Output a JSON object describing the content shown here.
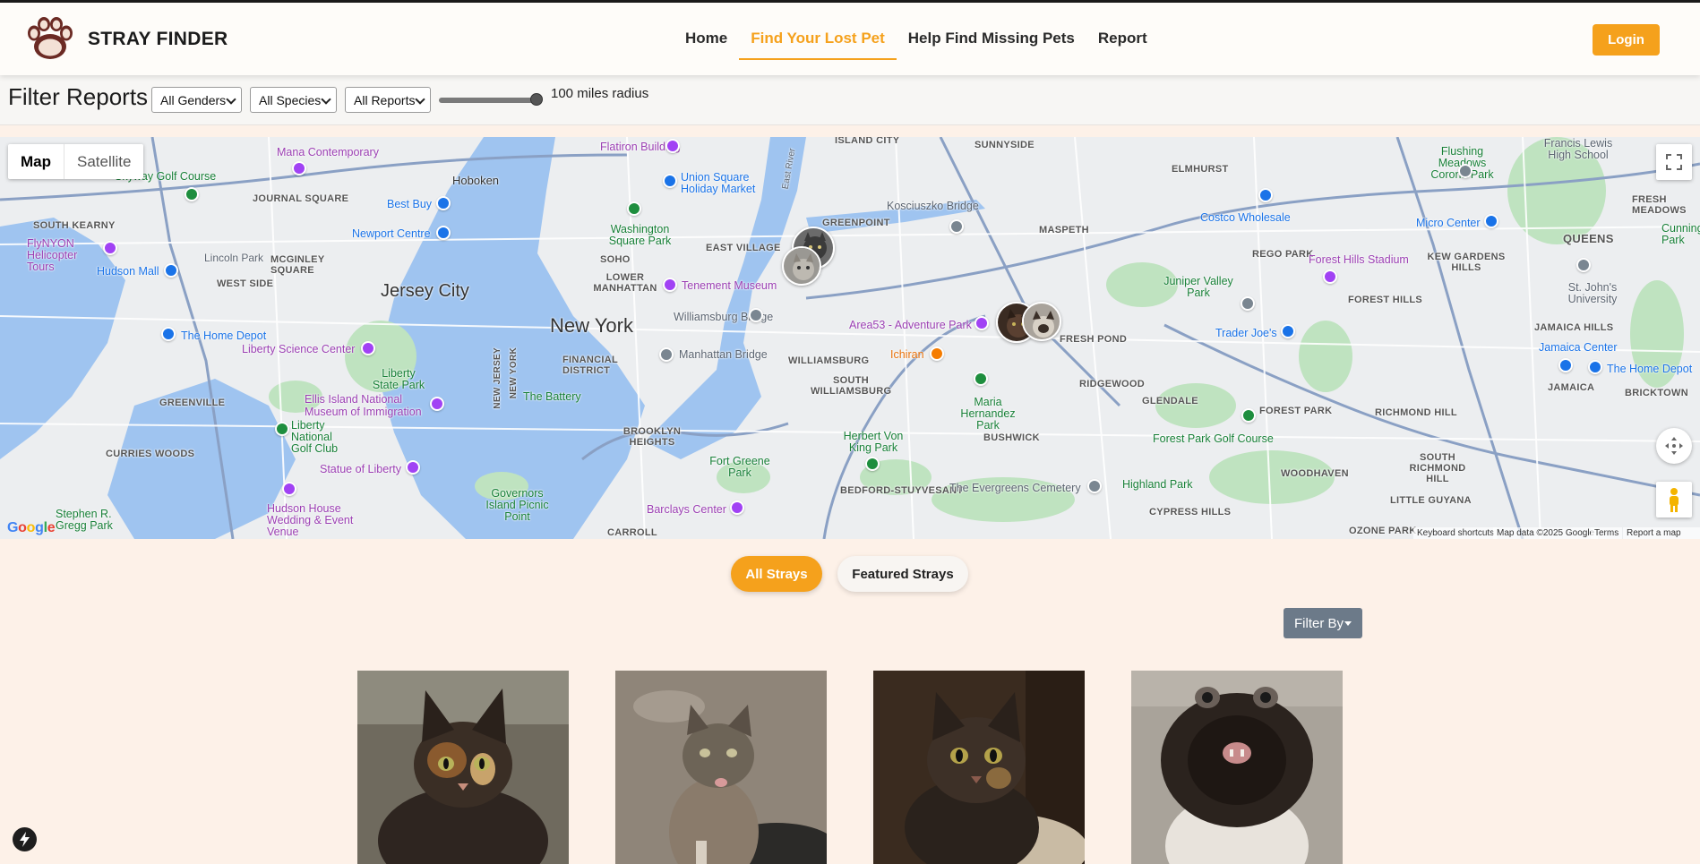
{
  "header": {
    "brand": "STRAY FINDER",
    "nav": [
      {
        "label": "Home",
        "active": false
      },
      {
        "label": "Find Your Lost Pet",
        "active": true
      },
      {
        "label": "Help Find Missing Pets",
        "active": false
      },
      {
        "label": "Report",
        "active": false
      }
    ],
    "login_label": "Login"
  },
  "filters": {
    "title": "Filter Reports",
    "gender": "All Genders",
    "species": "All Species",
    "reports": "All Reports",
    "radius_value": 100,
    "radius_label": "100 miles radius"
  },
  "map": {
    "type_map": "Map",
    "type_satellite": "Satellite",
    "google": "Google",
    "shortcuts": "Keyboard shortcuts",
    "map_data": "Map data ©2025 Google",
    "terms": "Terms",
    "report_error": "Report a map error",
    "labels": {
      "jersey_city": "Jersey City",
      "new_york": "New York",
      "hoboken": "Hoboken",
      "journal_square": "JOURNAL SQUARE",
      "south_kearny": "SOUTH KEARNY",
      "west_side": "WEST SIDE",
      "mcginley_square": "MCGINLEY SQUARE",
      "lincoln_park": "Lincoln Park",
      "greenville": "GREENVILLE",
      "curries_woods": "CURRIES WOODS",
      "soho": "SOHO",
      "lower_manhattan": "LOWER MANHATTAN",
      "east_village": "EAST VILLAGE",
      "financial_district": "FINANCIAL DISTRICT",
      "greenpoint": "GREENPOINT",
      "williamsburg": "WILLIAMSBURG",
      "south_williamsburg": "SOUTH WILLIAMSBURG",
      "brooklyn_heights": "BROOKLYN HEIGHTS",
      "bedford_stuyvesant": "BEDFORD-STUYVESANT",
      "bushwick": "BUSHWICK",
      "maspeth": "MASPETH",
      "ridgewood": "RIDGEWOOD",
      "glendale": "GLENDALE",
      "fresh_pond": "FRESH POND",
      "rego_park": "REGO PARK",
      "forest_hills": "FOREST HILLS",
      "kew_gardens_hills": "KEW GARDENS HILLS",
      "queens": "QUEENS",
      "elmhurst": "ELMHURST",
      "sunnyside": "SUNNYSIDE",
      "island_city": "ISLAND CITY",
      "jamaica_hills": "JAMAICA HILLS",
      "jamaica": "JAMAICA",
      "briarwood": "BRICKTOWN",
      "richmond_hill": "RICHMOND HILL",
      "south_richmond_hill": "SOUTH RICHMOND HILL",
      "woodhaven": "WOODHAVEN",
      "cypress_hills": "CYPRESS HILLS",
      "little_guyana": "LITTLE GUYANA",
      "ozone_park": "OZONE PARK",
      "carroll": "CARROLL",
      "forest_park": "FOREST PARK",
      "fresh_meadows": "FRESH MEADOWS",
      "flatiron": "Flatiron Building",
      "mana": "Mana Contemporary",
      "skyway": "Skyway Golf Course",
      "best_buy": "Best Buy",
      "newport": "Newport Centre",
      "flynyon": "FlyNYON Helicopter Tours",
      "hudson_mall": "Hudson Mall",
      "home_depot_nj": "The Home Depot",
      "liberty_science": "Liberty Science Center",
      "liberty_state_park": "Liberty State Park",
      "ellis_island": "Ellis Island National Museum of Immigration",
      "liberty_national": "Liberty National Golf Club",
      "statue_of_liberty": "Statue of Liberty",
      "hudson_house": "Hudson House Wedding & Event Venue",
      "governors_island": "Governors Island Picnic Point",
      "stephen_gregg": "Stephen R. Gregg Park",
      "union_square": "Union Square Holiday Market",
      "washington_square": "Washington Square Park",
      "tenement": "Tenement Museum",
      "williamsburg_bridge": "Williamsburg Bridge",
      "manhattan_bridge": "Manhattan Bridge",
      "the_battery": "The Battery",
      "fort_greene": "Fort Greene Park",
      "barclays": "Barclays Center",
      "kosciuszko": "Kosciuszko Bridge",
      "area53": "Area53 - Adventure Park",
      "ichiran": "Ichiran",
      "maria_hernandez": "Maria Hernandez Park",
      "herbert_von_king": "Herbert Von King Park",
      "evergreens": "The Evergreens Cemetery",
      "highland_park": "Highland Park",
      "forest_park_golf": "Forest Park Golf Course",
      "juniper_valley": "Juniper Valley Park",
      "trader_joes": "Trader Joe's",
      "costco": "Costco Wholesale",
      "micro_center": "Micro Center",
      "forest_hills_stadium": "Forest Hills Stadium",
      "francis_lewis": "Francis Lewis High School",
      "flushing_meadows": "Flushing Meadows Corona Park",
      "st_johns": "St. John's University",
      "jamaica_center": "Jamaica Center",
      "home_depot_ny": "The Home Depot",
      "cunningham": "Cunningha Park",
      "new_jersey_lbl": "NEW JERSEY",
      "new_york_lbl": "NEW YORK",
      "east_river": "East River"
    }
  },
  "tabs": {
    "all_strays": "All Strays",
    "featured_strays": "Featured Strays"
  },
  "filter_by": "Filter By",
  "cards": [
    {
      "name": "cat-card-1"
    },
    {
      "name": "cat-card-2"
    },
    {
      "name": "cat-card-3"
    },
    {
      "name": "cat-card-4"
    }
  ],
  "colors": {
    "accent": "#f5a11c",
    "page_bg": "#fdf1e8",
    "filter_btn": "#6c7a89"
  }
}
